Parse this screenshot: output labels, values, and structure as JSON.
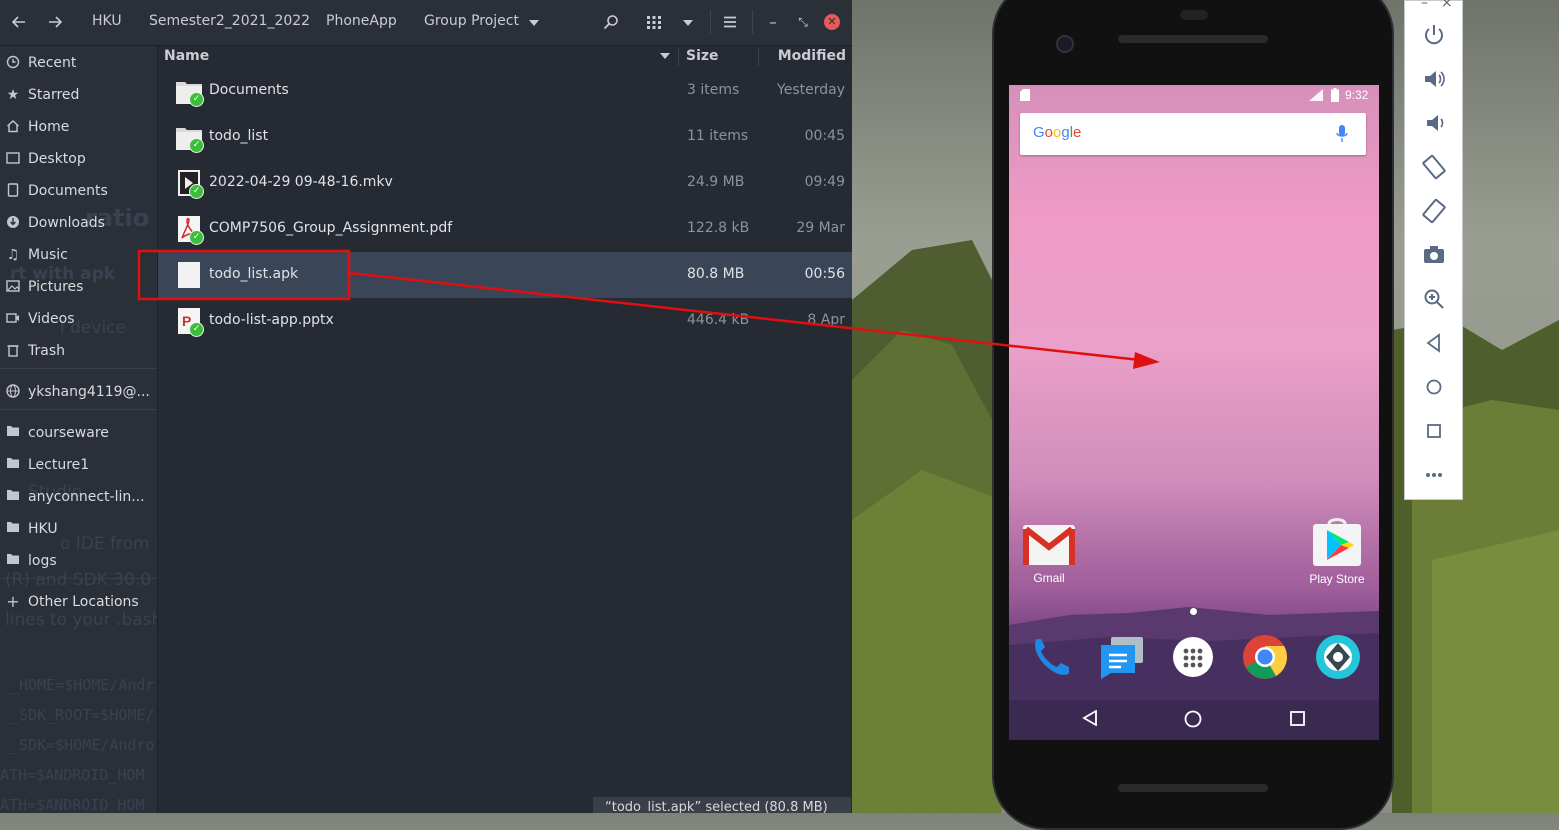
{
  "file_manager": {
    "toolbar": {
      "back_icon": "arrow-left-icon",
      "forward_icon": "arrow-right-icon",
      "breadcrumb": [
        "HKU",
        "Semester2_2021_2022",
        "PhoneApp",
        "Group Project"
      ],
      "search_icon": "search-icon",
      "view_icon": "grid-view-icon",
      "menu_icon": "hamburger-menu-icon",
      "minimize": "–",
      "maximize": "⤡",
      "close": "✕"
    },
    "sidebar": {
      "items": [
        {
          "label": "Recent",
          "icon": "clock-icon"
        },
        {
          "label": "Starred",
          "icon": "star-icon"
        },
        {
          "label": "Home",
          "icon": "home-icon"
        },
        {
          "label": "Desktop",
          "icon": "desktop-icon"
        },
        {
          "label": "Documents",
          "icon": "document-icon"
        },
        {
          "label": "Downloads",
          "icon": "download-icon"
        },
        {
          "label": "Music",
          "icon": "music-icon"
        },
        {
          "label": "Pictures",
          "icon": "pictures-icon"
        },
        {
          "label": "Videos",
          "icon": "video-icon"
        },
        {
          "label": "Trash",
          "icon": "trash-icon"
        },
        {
          "label": "ykshang4119@...",
          "icon": "network-icon"
        },
        {
          "label": "courseware",
          "icon": "folder-icon"
        },
        {
          "label": "Lecture1",
          "icon": "folder-icon"
        },
        {
          "label": "anyconnect-lin...",
          "icon": "folder-icon"
        },
        {
          "label": "HKU",
          "icon": "folder-icon"
        },
        {
          "label": "logs",
          "icon": "folder-icon"
        },
        {
          "label": "Other Locations",
          "icon": "plus-icon"
        }
      ]
    },
    "columns": {
      "name": "Name",
      "size": "Size",
      "modified": "Modified"
    },
    "files": [
      {
        "name": "Documents",
        "size": "3 items",
        "modified": "Yesterday",
        "type": "folder"
      },
      {
        "name": "todo_list",
        "size": "11 items",
        "modified": "00:45",
        "type": "folder"
      },
      {
        "name": "2022-04-29 09-48-16.mkv",
        "size": "24.9 MB",
        "modified": "09:49",
        "type": "video"
      },
      {
        "name": "COMP7506_Group_Assignment.pdf",
        "size": "122.8 kB",
        "modified": "29 Mar",
        "type": "pdf"
      },
      {
        "name": "todo_list.apk",
        "size": "80.8 MB",
        "modified": "00:56",
        "type": "apk",
        "selected": true
      },
      {
        "name": "todo-list-app.pptx",
        "size": "446.4 kB",
        "modified": "8 Apr",
        "type": "pptx"
      }
    ],
    "status": "“todo_list.apk” selected (80.8 MB)"
  },
  "phone": {
    "time": "9:32",
    "search_logo": "Google",
    "apps": [
      {
        "label": "Gmail",
        "icon": "gmail-icon"
      },
      {
        "label": "Play Store",
        "icon": "play-store-icon"
      }
    ],
    "dock": [
      "phone-icon",
      "messages-icon",
      "app-drawer-icon",
      "chrome-icon",
      "camera-icon"
    ],
    "nav": [
      "back-icon",
      "home-icon",
      "recents-icon"
    ]
  },
  "emulator_tools": [
    "power-icon",
    "volume-up-icon",
    "volume-down-icon",
    "rotate-left-icon",
    "rotate-right-icon",
    "screenshot-icon",
    "zoom-icon",
    "back-icon",
    "home-icon",
    "overview-icon",
    "more-icon"
  ],
  "colors": {
    "highlight_box": "#e01010",
    "arrow": "#e01010",
    "selected_row": "#3a4557",
    "badge": "#3bbf3b"
  }
}
